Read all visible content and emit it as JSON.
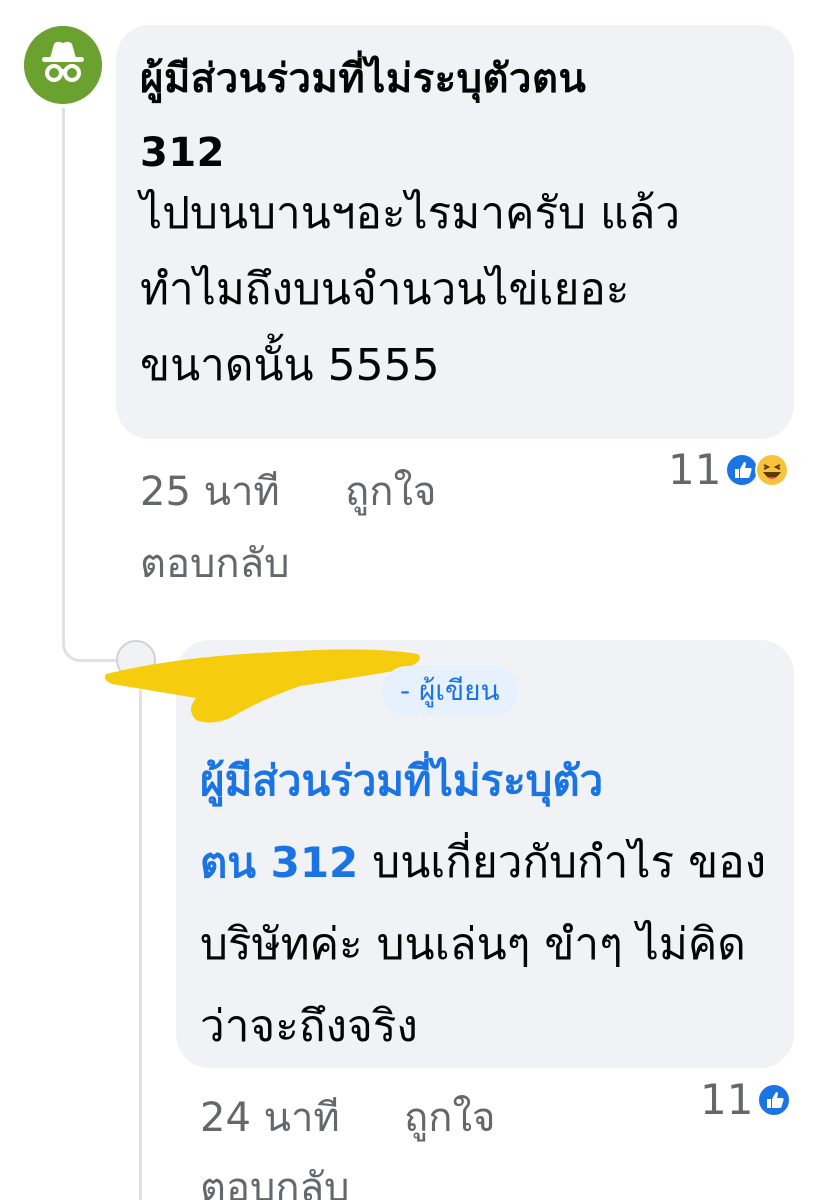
{
  "comments": [
    {
      "author": "ผู้มีส่วนร่วมที่ไม่ระบุตัวตน\n312",
      "text": "ไปบนบานฯอะไรมาครับ แล้ว\nทำไมถึงบนจำนวนไข่เยอะ\nขนาดนั้น 5555",
      "time": "25 นาที",
      "like_label": "ถูกใจ",
      "reply_label": "ตอบกลับ",
      "reaction_count": "11",
      "reactions": [
        "like-icon",
        "haha-icon"
      ],
      "avatar_icon": "incognito-icon",
      "avatar_color": "#6aa12f"
    },
    {
      "author_badge": "- ผู้เขียน",
      "mention": "ผู้มีส่วนร่วมที่ไม่ระบุตัว\nตน 312",
      "text": " บนเกี่ยวกับกำไร ของบริษัทค่ะ บนเล่นๆ ขำๆ ไม่คิดว่าจะถึงจริง",
      "time": "24 นาที",
      "like_label": "ถูกใจ",
      "reply_label": "ตอบกลับ",
      "reaction_count": "11",
      "reactions": [
        "like-icon"
      ],
      "mention_color": "#1b74e4",
      "redaction_color": "#f6cc0e"
    }
  ]
}
